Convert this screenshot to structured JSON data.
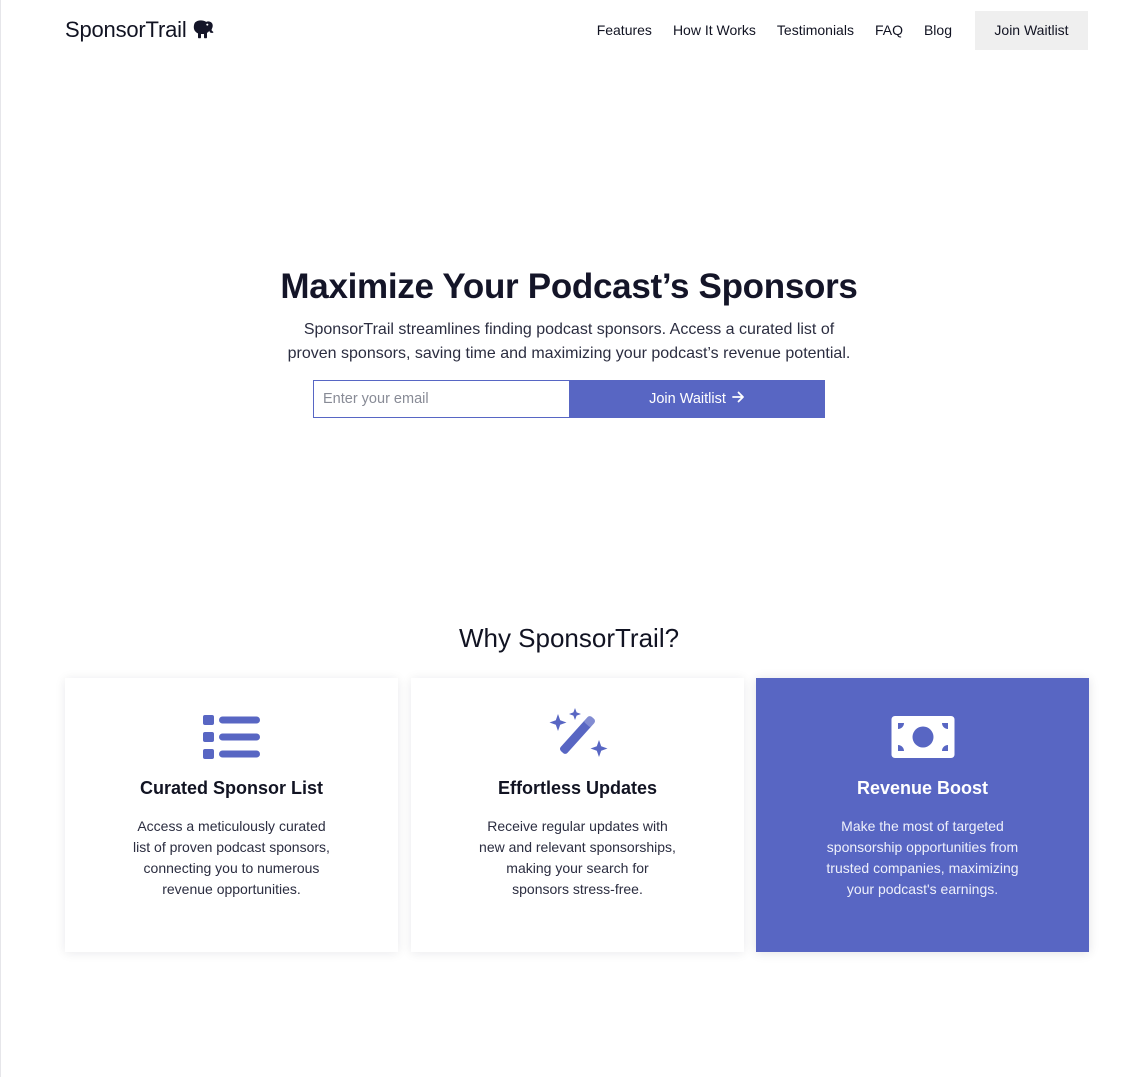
{
  "brand": {
    "name": "SponsorTrail",
    "logo_icon": "elephant-icon"
  },
  "nav": {
    "links": [
      "Features",
      "How It Works",
      "Testimonials",
      "FAQ",
      "Blog"
    ],
    "cta_label": "Join Waitlist"
  },
  "hero": {
    "title": "Maximize Your Podcast’s Sponsors",
    "subtitle": "SponsorTrail streamlines finding podcast sponsors. Access a curated list of proven sponsors, saving time and maximizing your podcast’s revenue potential.",
    "email_placeholder": "Enter your email",
    "email_value": "",
    "button_label": "Join Waitlist",
    "button_icon": "arrow-right-icon"
  },
  "features": {
    "title": "Why SponsorTrail?",
    "cards": [
      {
        "icon": "list-icon",
        "title": "Curated Sponsor List",
        "text": "Access a meticulously curated list of proven podcast sponsors, connecting you to numerous revenue opportunities."
      },
      {
        "icon": "magic-wand-icon",
        "title": "Effortless Updates",
        "text": "Receive regular updates with new and relevant sponsorships, making your search for sponsors stress-free."
      },
      {
        "icon": "money-bill-icon",
        "title": "Revenue Boost",
        "text": "Make the most of targeted sponsorship opportunities from trusted companies, maximizing your podcast's earnings."
      }
    ]
  },
  "colors": {
    "accent": "#5866c3",
    "text": "#111322",
    "nav_button_bg": "#efefef",
    "card_bg": "#ffffff"
  }
}
